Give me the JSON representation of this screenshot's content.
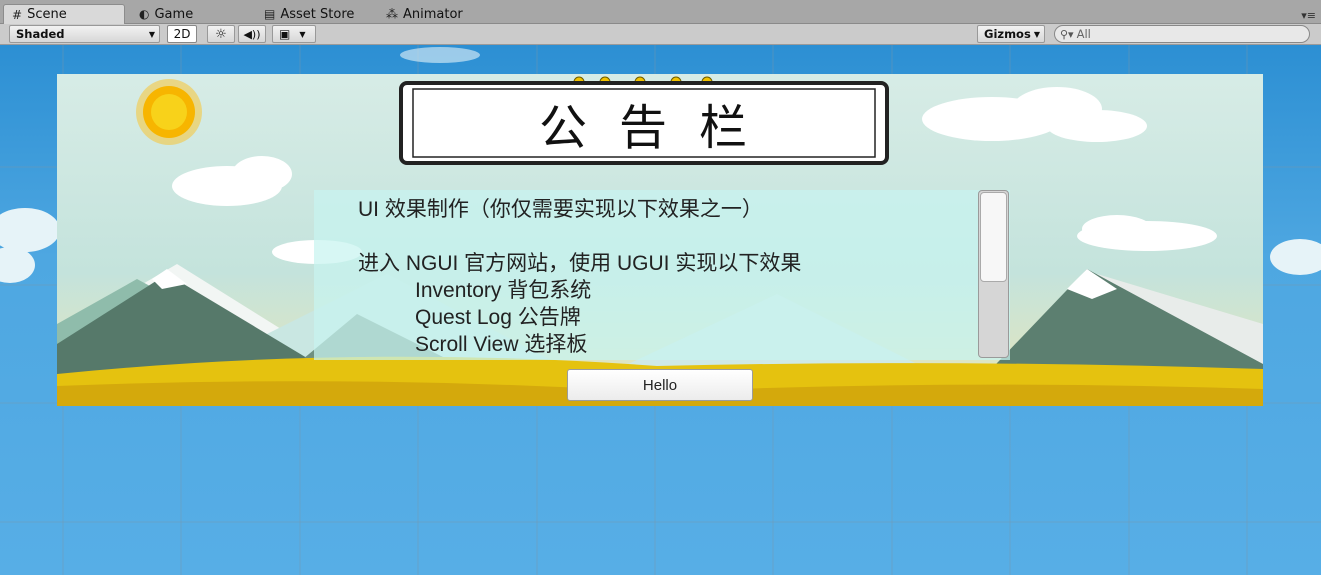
{
  "tabs": [
    {
      "label": "Scene",
      "icon": "grid-icon"
    },
    {
      "label": "Game",
      "icon": "pacman-icon"
    },
    {
      "label": "Asset Store",
      "icon": "shopping-bag-icon"
    },
    {
      "label": "Animator",
      "icon": "animator-icon"
    }
  ],
  "toolbar": {
    "shading_mode": "Shaded",
    "mode_2d": "2D",
    "gizmos": "Gizmos",
    "search_placeholder": "All"
  },
  "scene": {
    "board_title": "公告栏",
    "panel_lines": [
      "UI 效果制作（你仅需要实现以下效果之一）",
      "进入 NGUI 官方网站，使用 UGUI 实现以下效果",
      "Inventory 背包系统",
      "Quest Log 公告牌",
      "Scroll View 选择板"
    ],
    "button_label": "Hello"
  },
  "colors": {
    "sky": "#4ea7e1",
    "panel": "#c8f4f0",
    "sun": "#f7b500"
  }
}
